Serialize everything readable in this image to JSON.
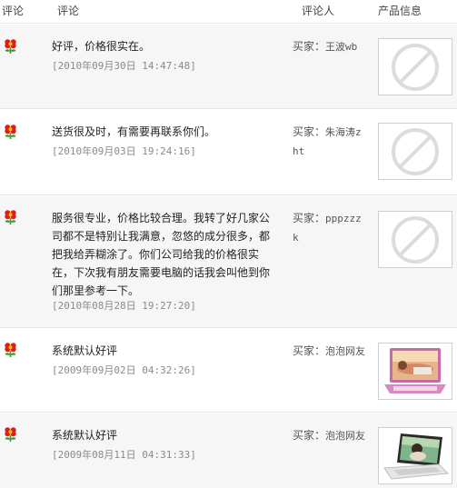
{
  "header": {
    "rating": "评论",
    "comment": "评论",
    "reviewer": "评论人",
    "product": "产品信息"
  },
  "reviews": [
    {
      "text": "好评，价格很实在。",
      "date": "[2010年09月30日 14:47:48]",
      "reviewer_prefix": "买家：",
      "reviewer_name": "王波wb",
      "thumb_icon": "no-image-icon"
    },
    {
      "text": "送货很及时，有需要再联系你们。",
      "date": "[2010年09月03日 19:24:16]",
      "reviewer_prefix": "买家：",
      "reviewer_name": "朱海涛zht",
      "thumb_icon": "no-image-icon"
    },
    {
      "text": "服务很专业，价格比较合理。我转了好几家公司都不是特别让我满意，忽悠的成分很多，都把我给弄糊涂了。你们公司给我的价格很实在，下次我有朋友需要电脑的话我会叫他到你们那里参考一下。",
      "date": "[2010年08月28日 19:27:20]",
      "reviewer_prefix": "买家：",
      "reviewer_name": "pppzzzk",
      "thumb_icon": "no-image-icon"
    },
    {
      "text": "系统默认好评",
      "date": "[2009年09月02日 04:32:26]",
      "reviewer_prefix": "买家：",
      "reviewer_name": "泡泡网友",
      "thumb_icon": "pink-laptop-image"
    },
    {
      "text": "系统默认好评",
      "date": "[2009年08月11日 04:31:33]",
      "reviewer_prefix": "买家：",
      "reviewer_name": "泡泡网友",
      "thumb_icon": "white-laptop-image"
    }
  ],
  "colors": {
    "rating_flower": "#d9201c",
    "rating_leaf": "#3a9a2a",
    "row_alt_bg": "#f6f6f6",
    "date_text": "#8a8a8a"
  }
}
